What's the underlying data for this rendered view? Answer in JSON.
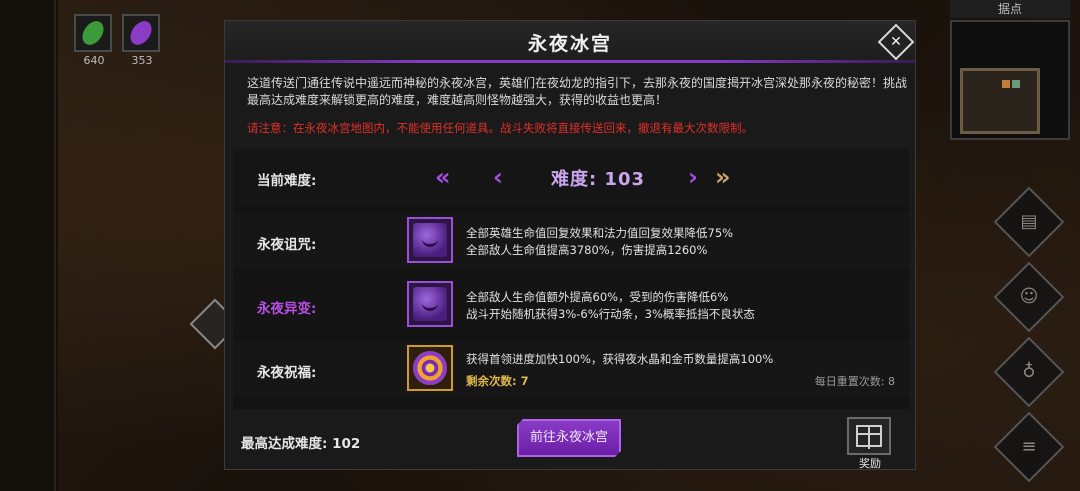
{
  "resources": [
    {
      "value": "640",
      "icon": "green-feather-icon",
      "color": "#3b9b3a"
    },
    {
      "value": "353",
      "icon": "purple-feather-icon",
      "color": "#8a3cc7"
    }
  ],
  "minimap": {
    "title": "据点"
  },
  "side_buttons": [
    {
      "icon": "scroll-icon",
      "glyph": "▤"
    },
    {
      "icon": "party-icon",
      "glyph": "☺"
    },
    {
      "icon": "potion-icon",
      "glyph": "♁"
    },
    {
      "icon": "menu-icon",
      "glyph": "≡"
    }
  ],
  "modal": {
    "title": "永夜冰宫",
    "close_glyph": "✕",
    "description": "这道传送门通往传说中遥远而神秘的永夜冰宫，英雄们在夜幼龙的指引下，去那永夜的国度揭开冰宫深处那永夜的秘密！挑战最高达成难度来解锁更高的难度，难度越高则怪物越强大，获得的收益也更高！",
    "warning": "请注意：在永夜冰宫地图内，不能使用任何道具。战斗失败将直接传送回来，撤退有最大次数限制。",
    "difficulty": {
      "label": "当前难度:",
      "value_text": "难度: 103",
      "left_double": "«",
      "left_single": "‹",
      "right_single": "›",
      "right_double": "»"
    },
    "curse": {
      "label": "永夜诅咒:",
      "lines": [
        "全部英雄生命值回复效果和法力值回复效果降低75%",
        "全部敌人生命值提高3780%，伤害提高1260%"
      ]
    },
    "mutation": {
      "label": "永夜异变:",
      "lines": [
        "全部敌人生命值额外提高60%，受到的伤害降低6%",
        "战斗开始随机获得3%-6%行动条，3%概率抵挡不良状态"
      ]
    },
    "blessing": {
      "label": "永夜祝福:",
      "line": "获得首领进度加快100%，获得夜水晶和金币数量提高100%",
      "remaining": "剩余次数: 7",
      "daily_reset": "每日重置次数: 8"
    },
    "best": "最高达成难度: 102",
    "go_button": "前往永夜冰宫",
    "reward_label": "奖励"
  },
  "colors": {
    "accent_purple": "#8a3cc7",
    "warning_red": "#e0302a",
    "gold": "#e0b84a"
  }
}
